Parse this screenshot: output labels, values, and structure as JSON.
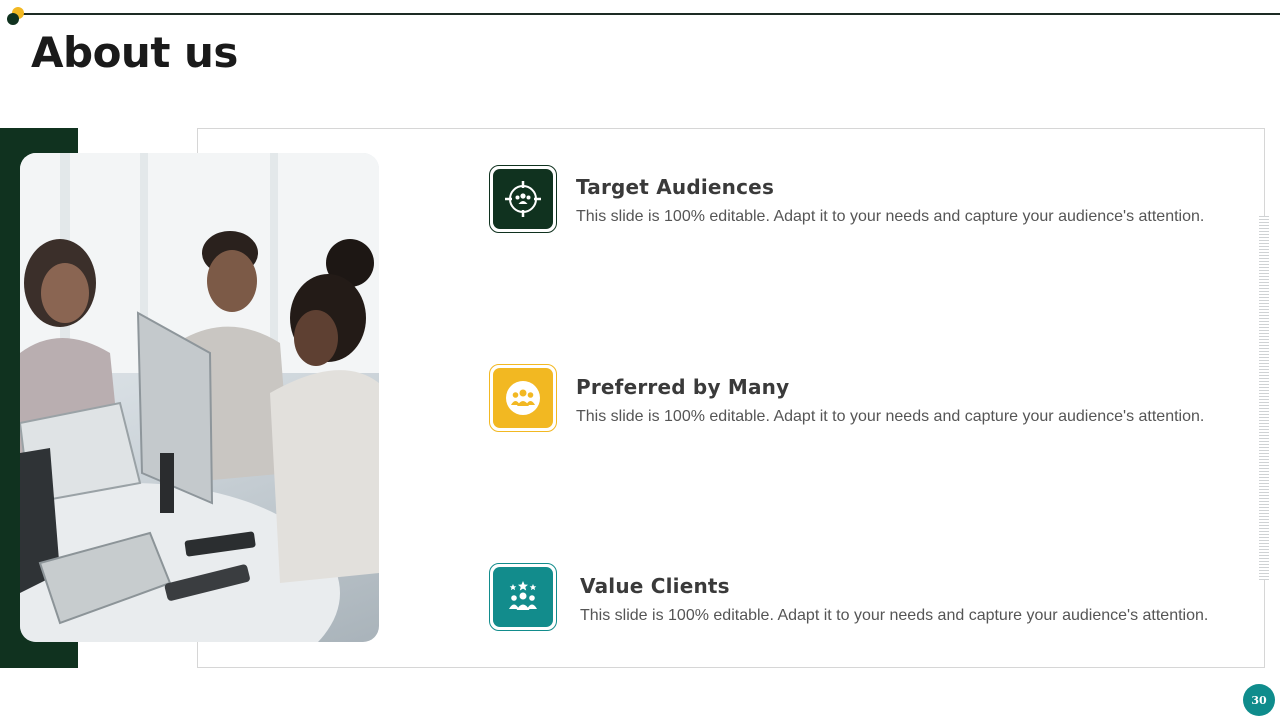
{
  "slide": {
    "title": "About us",
    "page_number": "30"
  },
  "photo": {
    "icon": "office-team-photo"
  },
  "items": [
    {
      "title": "Target Audiences",
      "description": "This slide is 100% editable. Adapt it to your needs and capture your audience's attention.",
      "icon": "target-audience-icon",
      "color": "#10321f"
    },
    {
      "title": "Preferred by Many",
      "description": "This slide is 100% editable. Adapt it to your needs and capture your audience's attention.",
      "icon": "group-icon",
      "color": "#f2b822"
    },
    {
      "title": "Value Clients",
      "description": "This slide is 100% editable. Adapt it to your needs and capture your audience's attention.",
      "icon": "value-clients-icon",
      "color": "#128c8c"
    }
  ],
  "colors": {
    "dark_green": "#10321f",
    "yellow": "#f2b822",
    "teal": "#128c8c"
  }
}
